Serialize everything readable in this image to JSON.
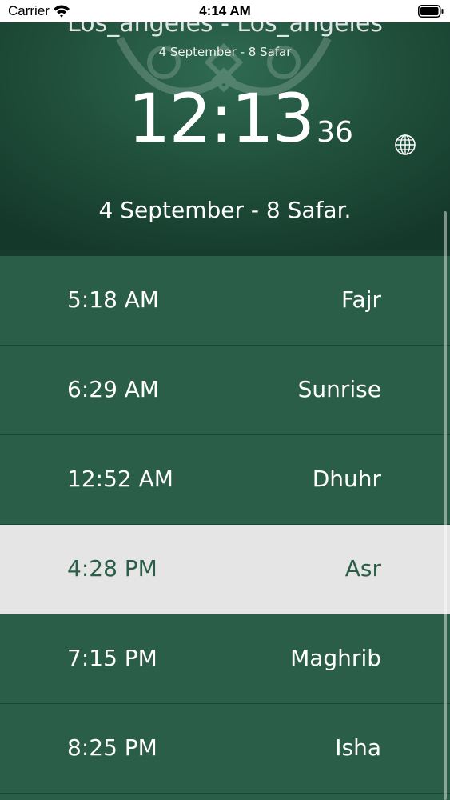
{
  "status_bar": {
    "carrier": "Carrier",
    "time": "4:14 AM"
  },
  "header": {
    "city": "Los_angeles - Los_angeles",
    "small_date": "4 September - 8 Safar",
    "clock_main": "12:13",
    "clock_seconds": "36",
    "full_date": "4 September - 8 Safar."
  },
  "prayers": [
    {
      "time": "5:18 AM",
      "name": "Fajr"
    },
    {
      "time": "6:29 AM",
      "name": "Sunrise"
    },
    {
      "time": "12:52 AM",
      "name": "Dhuhr"
    },
    {
      "time": "4:28 PM",
      "name": "Asr"
    },
    {
      "time": "7:15 PM",
      "name": "Maghrib"
    },
    {
      "time": "8:25 PM",
      "name": "Isha"
    }
  ],
  "colors": {
    "primary_green": "#2b5e48",
    "highlight_row": "#e5e5e5"
  },
  "icons": [
    "wifi-icon",
    "battery-icon",
    "globe-icon"
  ]
}
